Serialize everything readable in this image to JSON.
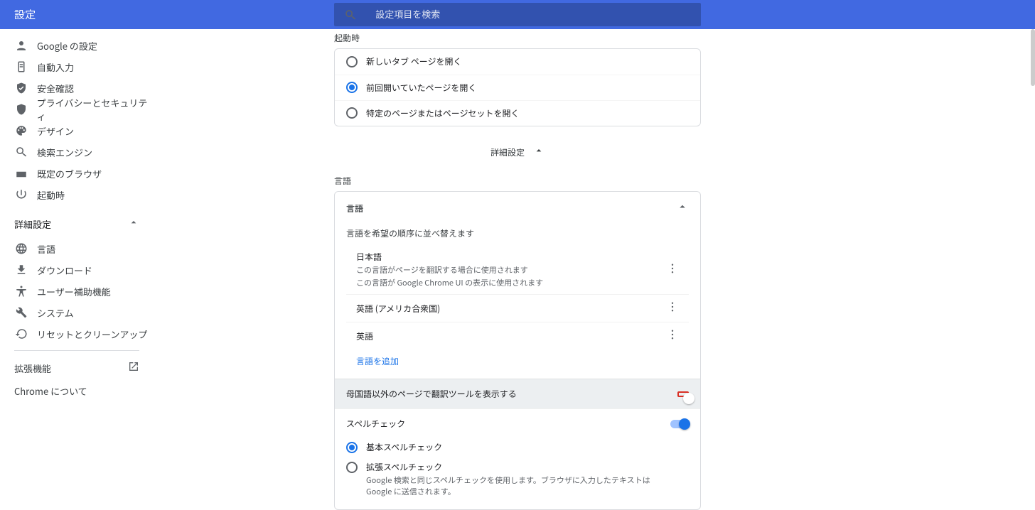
{
  "header": {
    "title": "設定",
    "search_placeholder": "設定項目を検索"
  },
  "sidebar": {
    "basic": [
      {
        "label": "Google の設定",
        "icon": "person"
      },
      {
        "label": "自動入力",
        "icon": "clipboard"
      },
      {
        "label": "安全確認",
        "icon": "shield-check"
      },
      {
        "label": "プライバシーとセキュリティ",
        "icon": "shield"
      },
      {
        "label": "デザイン",
        "icon": "palette"
      },
      {
        "label": "検索エンジン",
        "icon": "search"
      },
      {
        "label": "既定のブラウザ",
        "icon": "browser"
      },
      {
        "label": "起動時",
        "icon": "power"
      }
    ],
    "adv_label": "詳細設定",
    "adv": [
      {
        "label": "言語",
        "icon": "globe"
      },
      {
        "label": "ダウンロード",
        "icon": "download"
      },
      {
        "label": "ユーザー補助機能",
        "icon": "accessibility"
      },
      {
        "label": "システム",
        "icon": "wrench"
      },
      {
        "label": "リセットとクリーンアップ",
        "icon": "restore"
      }
    ],
    "extensions": "拡張機能",
    "about": "Chrome について"
  },
  "startup": {
    "heading": "起動時",
    "options": [
      {
        "label": "新しいタブ ページを開く",
        "checked": false
      },
      {
        "label": "前回開いていたページを開く",
        "checked": true
      },
      {
        "label": "特定のページまたはページセットを開く",
        "checked": false
      }
    ]
  },
  "adv_divider_label": "詳細設定",
  "language": {
    "heading": "言語",
    "card_head": "言語",
    "reorder_desc": "言語を希望の順序に並べ替えます",
    "items": [
      {
        "name": "日本語",
        "sub1": "この言語がページを翻訳する場合に使用されます",
        "sub2": "この言語が Google Chrome UI の表示に使用されます"
      },
      {
        "name": "英語 (アメリカ合衆国)"
      },
      {
        "name": "英語"
      }
    ],
    "add": "言語を追加",
    "translate_row": "母国語以外のページで翻訳ツールを表示する",
    "spell_head": "スペルチェック",
    "spell_options": [
      {
        "label": "基本スペルチェック",
        "checked": true
      },
      {
        "label": "拡張スペルチェック",
        "sub": "Google 検索と同じスペルチェックを使用します。ブラウザに入力したテキストは Google に送信されます。",
        "checked": false
      }
    ]
  }
}
